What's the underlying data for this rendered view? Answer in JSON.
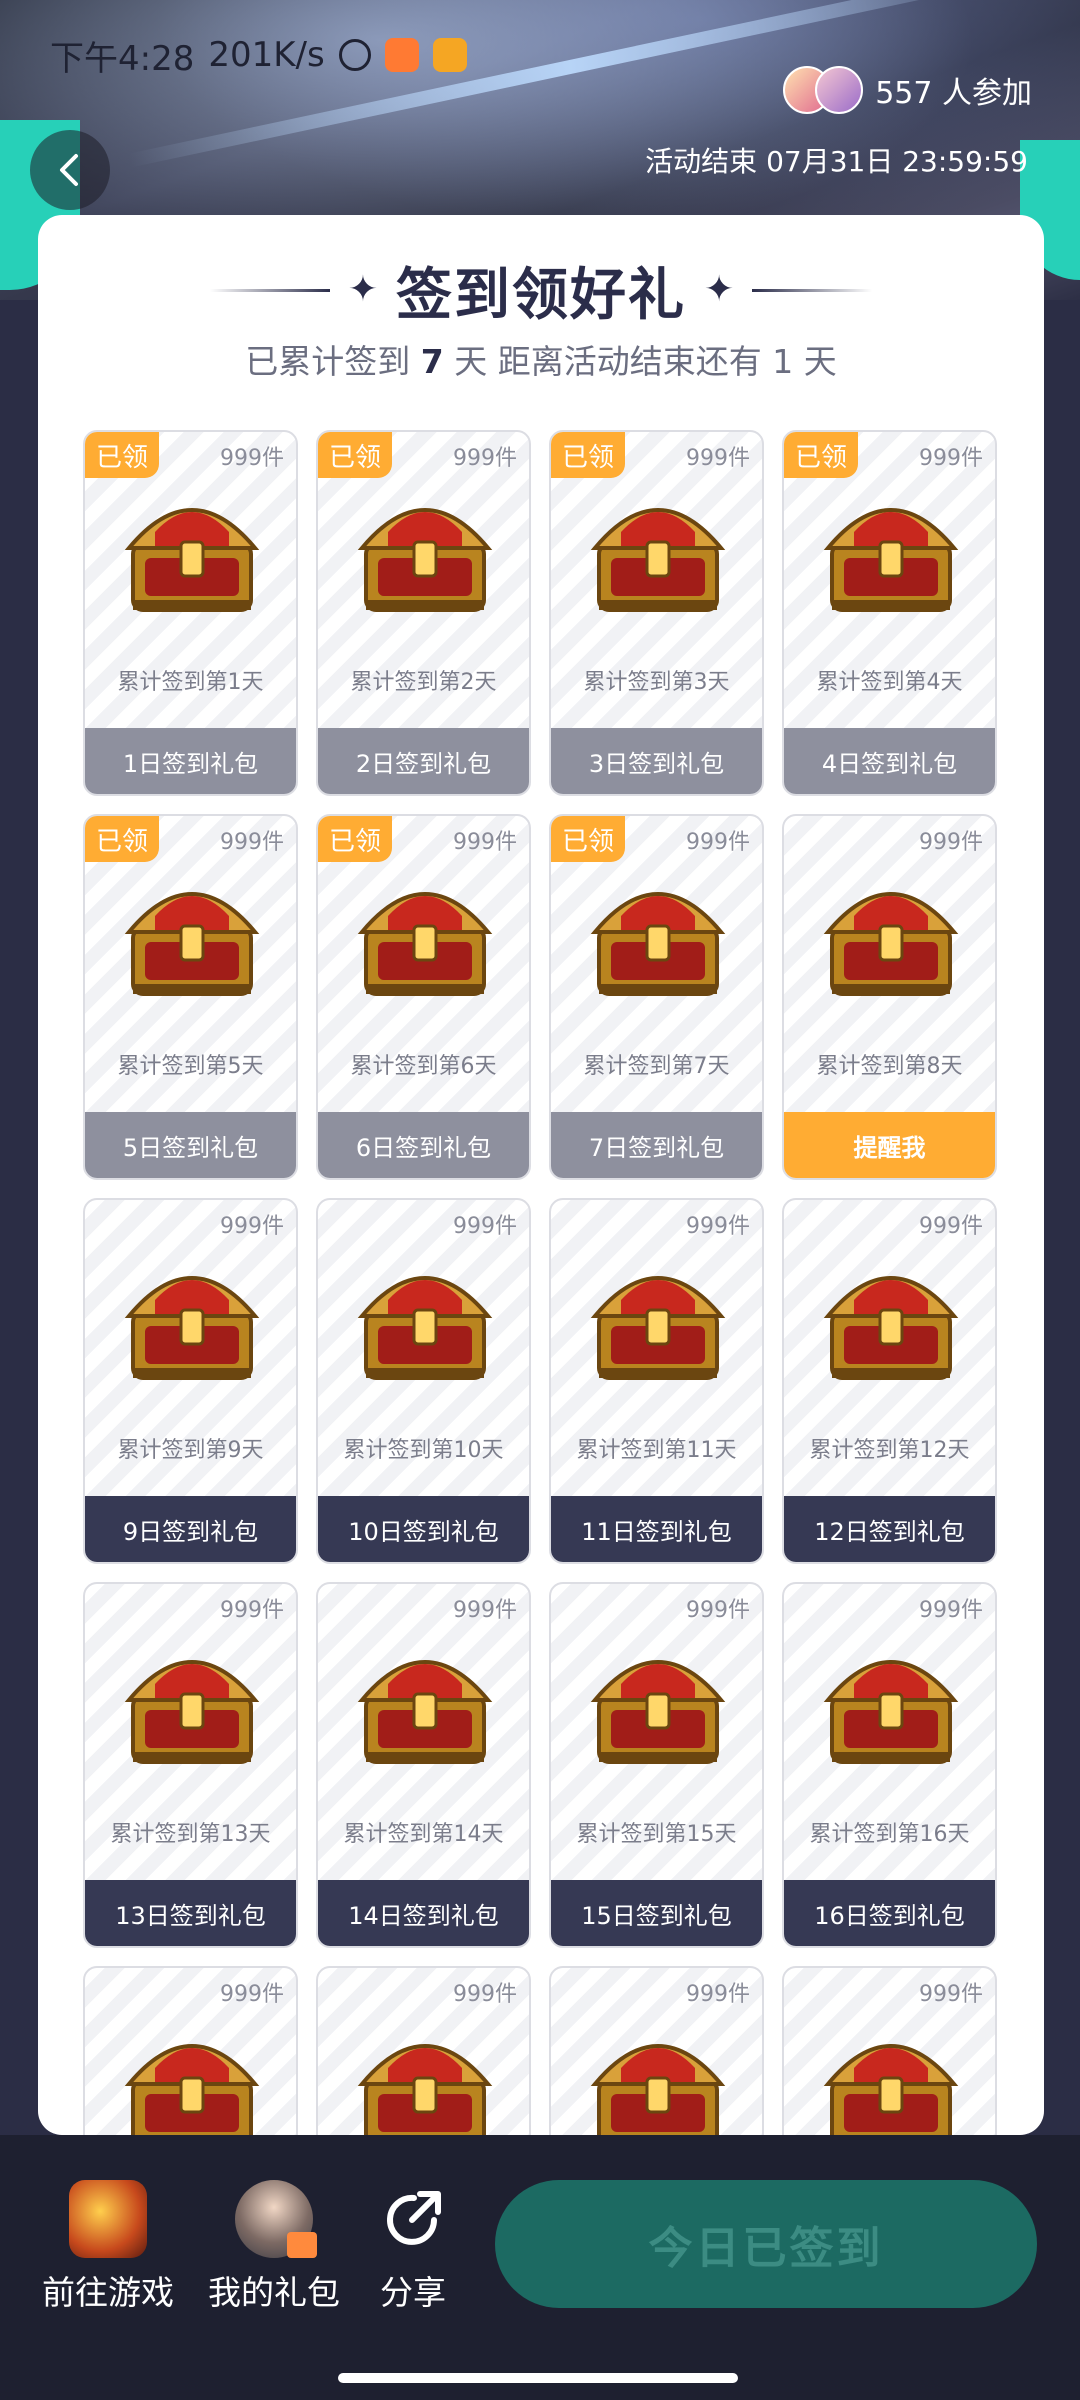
{
  "status_bar": {
    "time": "下午4:28",
    "speed": "201K/s"
  },
  "header": {
    "participants": "557 人参加",
    "end_time": "活动结束 07月31日 23:59:59"
  },
  "card": {
    "title": "签到领好礼",
    "subtitle_prefix": "已累计签到",
    "signed_days": "7",
    "subtitle_mid": "天 距离活动结束还有",
    "remaining_days": "1",
    "subtitle_suffix": "天"
  },
  "gifts": [
    {
      "badge": "已领",
      "stock": "999件",
      "day": "累计签到第1天",
      "button": "1日签到礼包",
      "state": "claimed"
    },
    {
      "badge": "已领",
      "stock": "999件",
      "day": "累计签到第2天",
      "button": "2日签到礼包",
      "state": "claimed"
    },
    {
      "badge": "已领",
      "stock": "999件",
      "day": "累计签到第3天",
      "button": "3日签到礼包",
      "state": "claimed"
    },
    {
      "badge": "已领",
      "stock": "999件",
      "day": "累计签到第4天",
      "button": "4日签到礼包",
      "state": "claimed"
    },
    {
      "badge": "已领",
      "stock": "999件",
      "day": "累计签到第5天",
      "button": "5日签到礼包",
      "state": "claimed"
    },
    {
      "badge": "已领",
      "stock": "999件",
      "day": "累计签到第6天",
      "button": "6日签到礼包",
      "state": "claimed"
    },
    {
      "badge": "已领",
      "stock": "999件",
      "day": "累计签到第7天",
      "button": "7日签到礼包",
      "state": "claimed"
    },
    {
      "badge": "",
      "stock": "999件",
      "day": "累计签到第8天",
      "button": "提醒我",
      "state": "remind"
    },
    {
      "badge": "",
      "stock": "999件",
      "day": "累计签到第9天",
      "button": "9日签到礼包",
      "state": "future"
    },
    {
      "badge": "",
      "stock": "999件",
      "day": "累计签到第10天",
      "button": "10日签到礼包",
      "state": "future"
    },
    {
      "badge": "",
      "stock": "999件",
      "day": "累计签到第11天",
      "button": "11日签到礼包",
      "state": "future"
    },
    {
      "badge": "",
      "stock": "999件",
      "day": "累计签到第12天",
      "button": "12日签到礼包",
      "state": "future"
    },
    {
      "badge": "",
      "stock": "999件",
      "day": "累计签到第13天",
      "button": "13日签到礼包",
      "state": "future"
    },
    {
      "badge": "",
      "stock": "999件",
      "day": "累计签到第14天",
      "button": "14日签到礼包",
      "state": "future"
    },
    {
      "badge": "",
      "stock": "999件",
      "day": "累计签到第15天",
      "button": "15日签到礼包",
      "state": "future"
    },
    {
      "badge": "",
      "stock": "999件",
      "day": "累计签到第16天",
      "button": "16日签到礼包",
      "state": "future"
    },
    {
      "badge": "",
      "stock": "999件",
      "day": "",
      "button": "",
      "state": "future"
    },
    {
      "badge": "",
      "stock": "999件",
      "day": "",
      "button": "",
      "state": "future"
    },
    {
      "badge": "",
      "stock": "999件",
      "day": "",
      "button": "",
      "state": "future"
    },
    {
      "badge": "",
      "stock": "999件",
      "day": "",
      "button": "",
      "state": "future"
    }
  ],
  "bottom_bar": {
    "go_game": "前往游戏",
    "my_gifts": "我的礼包",
    "share": "分享",
    "checkin": "今日已签到"
  },
  "icons": {
    "back": "chevron-left-icon",
    "share": "share-icon",
    "chest": "treasure-chest-icon"
  },
  "colors": {
    "accent_orange": "#ffac33",
    "teal": "#1c6a62",
    "dark": "#363954"
  }
}
